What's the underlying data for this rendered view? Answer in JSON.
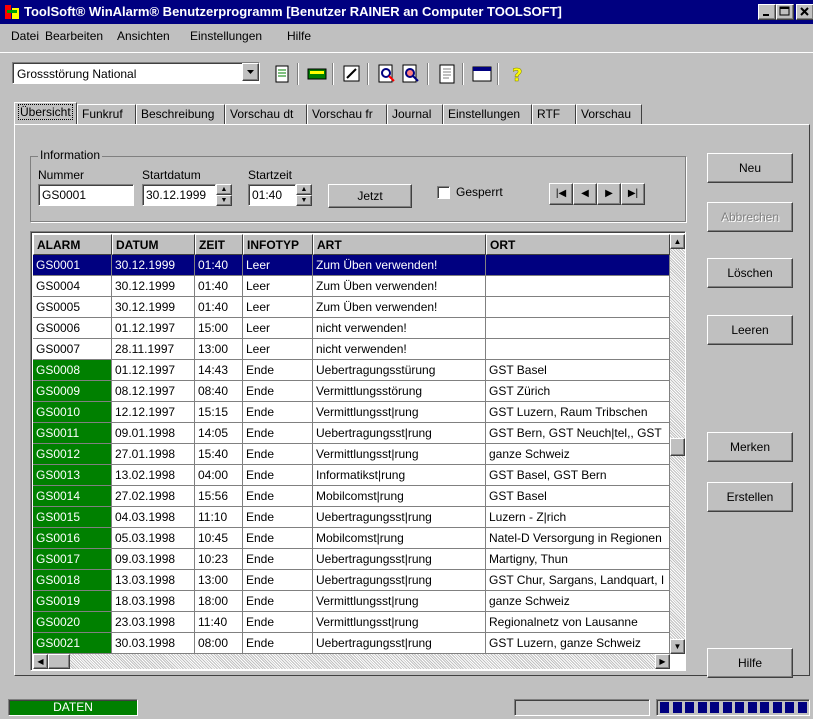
{
  "window": {
    "title": "ToolSoft® WinAlarm® Benutzerprogramm [Benutzer RAINER an Computer TOOLSOFT]"
  },
  "menu": [
    {
      "label": "Datei"
    },
    {
      "label": "Bearbeiten"
    },
    {
      "label": "Ansichten"
    },
    {
      "label": "Einstellungen"
    },
    {
      "label": "Hilfe"
    }
  ],
  "toolbar": {
    "dataset_value": "Grossstörung National",
    "icons": [
      "list-icon",
      "keyboard-icon",
      "edit-icon",
      "search-doc-icon",
      "search-page-icon",
      "document-icon",
      "window-icon",
      "help-icon"
    ]
  },
  "tabs": [
    {
      "label": "Übersicht",
      "active": true
    },
    {
      "label": "Funkruf"
    },
    {
      "label": "Beschreibung"
    },
    {
      "label": "Vorschau dt"
    },
    {
      "label": "Vorschau fr"
    },
    {
      "label": "Journal"
    },
    {
      "label": "Einstellungen"
    },
    {
      "label": "RTF"
    },
    {
      "label": "Vorschau"
    }
  ],
  "info": {
    "legend": "Information",
    "nummer_label": "Nummer",
    "nummer_value": "GS0001",
    "startdatum_label": "Startdatum",
    "startdatum_value": "30.12.1999",
    "startzeit_label": "Startzeit",
    "startzeit_value": "01:40",
    "jetzt_label": "Jetzt",
    "gesperrt_label": "Gesperrt",
    "gesperrt_checked": false
  },
  "buttons": {
    "neu": "Neu",
    "abbrechen": "Abbrechen",
    "loeschen": "Löschen",
    "leeren": "Leeren",
    "merken": "Merken",
    "erstellen": "Erstellen",
    "hilfe": "Hilfe"
  },
  "table": {
    "columns": [
      "ALARM",
      "DATUM",
      "ZEIT",
      "INFOTYP",
      "ART",
      "ORT"
    ],
    "rows": [
      {
        "alarm": "GS0001",
        "datum": "30.12.1999",
        "zeit": "01:40",
        "infotyp": "Leer",
        "art": "Zum Üben verwenden!",
        "ort": "",
        "selected": true,
        "green": false
      },
      {
        "alarm": "GS0004",
        "datum": "30.12.1999",
        "zeit": "01:40",
        "infotyp": "Leer",
        "art": "Zum Üben verwenden!",
        "ort": "",
        "green": false
      },
      {
        "alarm": "GS0005",
        "datum": "30.12.1999",
        "zeit": "01:40",
        "infotyp": "Leer",
        "art": "Zum Üben verwenden!",
        "ort": "",
        "green": false
      },
      {
        "alarm": "GS0006",
        "datum": "01.12.1997",
        "zeit": "15:00",
        "infotyp": "Leer",
        "art": "nicht verwenden!",
        "ort": "",
        "green": false
      },
      {
        "alarm": "GS0007",
        "datum": "28.11.1997",
        "zeit": "13:00",
        "infotyp": "Leer",
        "art": "nicht verwenden!",
        "ort": "",
        "green": false
      },
      {
        "alarm": "GS0008",
        "datum": "01.12.1997",
        "zeit": "14:43",
        "infotyp": "Ende",
        "art": "Uebertragungsstürung",
        "ort": "GST Basel",
        "green": true
      },
      {
        "alarm": "GS0009",
        "datum": "08.12.1997",
        "zeit": "08:40",
        "infotyp": "Ende",
        "art": "Vermittlungsstörung",
        "ort": "GST Zürich",
        "green": true
      },
      {
        "alarm": "GS0010",
        "datum": "12.12.1997",
        "zeit": "15:15",
        "infotyp": "Ende",
        "art": "Vermittlungsst|rung",
        "ort": "GST Luzern, Raum Tribschen",
        "green": true
      },
      {
        "alarm": "GS0011",
        "datum": "09.01.1998",
        "zeit": "14:05",
        "infotyp": "Ende",
        "art": "Uebertragungsst|rung",
        "ort": "GST Bern, GST Neuch|tel,, GST",
        "green": true
      },
      {
        "alarm": "GS0012",
        "datum": "27.01.1998",
        "zeit": "15:40",
        "infotyp": "Ende",
        "art": "Vermittlungsst|rung",
        "ort": "ganze Schweiz",
        "green": true
      },
      {
        "alarm": "GS0013",
        "datum": "13.02.1998",
        "zeit": "04:00",
        "infotyp": "Ende",
        "art": "Informatikst|rung",
        "ort": "GST Basel, GST Bern",
        "green": true
      },
      {
        "alarm": "GS0014",
        "datum": "27.02.1998",
        "zeit": "15:56",
        "infotyp": "Ende",
        "art": "Mobilcomst|rung",
        "ort": "GST Basel",
        "green": true
      },
      {
        "alarm": "GS0015",
        "datum": "04.03.1998",
        "zeit": "11:10",
        "infotyp": "Ende",
        "art": "Uebertragungsst|rung",
        "ort": "Luzern - Z|rich",
        "green": true
      },
      {
        "alarm": "GS0016",
        "datum": "05.03.1998",
        "zeit": "10:45",
        "infotyp": "Ende",
        "art": "Mobilcomst|rung",
        "ort": "Natel-D Versorgung in Regionen",
        "green": true
      },
      {
        "alarm": "GS0017",
        "datum": "09.03.1998",
        "zeit": "10:23",
        "infotyp": "Ende",
        "art": "Uebertragungsst|rung",
        "ort": "Martigny, Thun",
        "green": true
      },
      {
        "alarm": "GS0018",
        "datum": "13.03.1998",
        "zeit": "13:00",
        "infotyp": "Ende",
        "art": "Uebertragungsst|rung",
        "ort": "GST Chur, Sargans, Landquart, I",
        "green": true
      },
      {
        "alarm": "GS0019",
        "datum": "18.03.1998",
        "zeit": "18:00",
        "infotyp": "Ende",
        "art": "Vermittlungsst|rung",
        "ort": "ganze Schweiz",
        "green": true
      },
      {
        "alarm": "GS0020",
        "datum": "23.03.1998",
        "zeit": "11:40",
        "infotyp": "Ende",
        "art": "Vermittlungsst|rung",
        "ort": "Regionalnetz von Lausanne",
        "green": true
      },
      {
        "alarm": "GS0021",
        "datum": "30.03.1998",
        "zeit": "08:00",
        "infotyp": "Ende",
        "art": "Uebertragungsst|rung",
        "ort": "GST Luzern, ganze Schweiz",
        "green": true
      }
    ]
  },
  "status": {
    "db_label": "DATEN",
    "progress_blocks": 12
  },
  "colors": {
    "titlebar": "#000080",
    "selection": "#000080",
    "green": "#008000"
  }
}
